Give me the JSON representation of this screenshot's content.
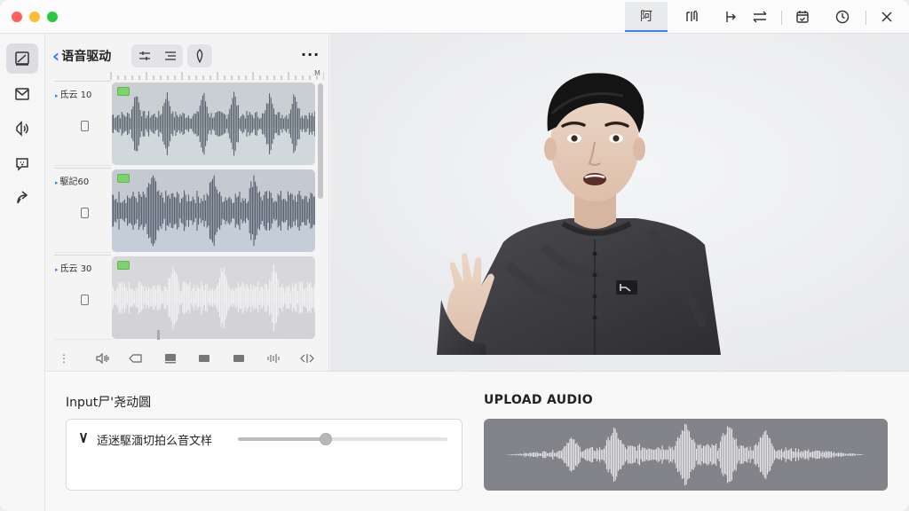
{
  "toolbar": {
    "active_tab_label": "阿",
    "icons": [
      "mixer-icon",
      "music-note-icon",
      "arrow-right-icon",
      "swap-icon",
      "calendar-check-icon",
      "history-icon",
      "close-icon"
    ]
  },
  "rail": {
    "items": [
      "canvas-icon",
      "mail-icon",
      "audio-icon",
      "chat-icon",
      "share-icon"
    ],
    "active": "canvas-icon"
  },
  "panel": {
    "back_label": "语音驱动",
    "more_label": "···",
    "ruler_end_label": "M",
    "tracks": [
      {
        "name": "氐云 10",
        "style": "light"
      },
      {
        "name": "駆記60",
        "style": "dark"
      },
      {
        "name": "氐云 30",
        "style": "faded"
      }
    ],
    "footer_icons": [
      "more-vertical-icon",
      "volume-icon",
      "tag-icon",
      "film-icon",
      "screen-icon",
      "monitor-icon",
      "waveform-icon",
      "split-icon"
    ]
  },
  "input_section": {
    "title": "Input尸'尧动圆",
    "text": "适迷駆湎切拍么音文样",
    "slider_value": 0.42
  },
  "upload_section": {
    "title": "UPLOAD AUDIO"
  },
  "colors": {
    "accent": "#2f7cf6",
    "traffic_red": "#ff5f57",
    "traffic_yellow": "#febc2e",
    "traffic_green": "#28c840",
    "clip_tag": "#7fd36e",
    "upload_bg": "#838489"
  }
}
